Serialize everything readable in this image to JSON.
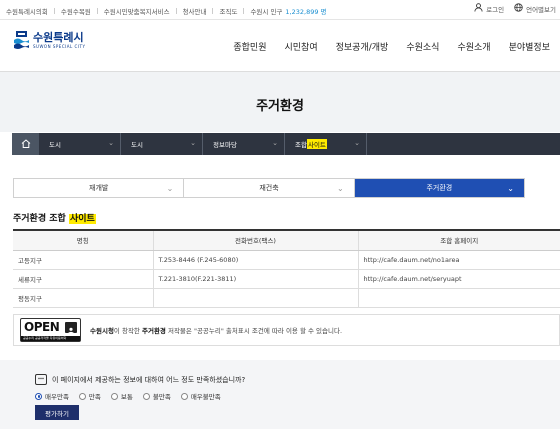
{
  "topbar": {
    "links": [
      "수원특례시의회",
      "수원수목원",
      "수원시민맞춤복지서비스",
      "청사안내",
      "조직도"
    ],
    "population_label": "수원시 인구",
    "population_value": "1,232,899 명",
    "login": "로그인",
    "language": "언어별보기"
  },
  "header": {
    "logo_text": "수원특례시",
    "logo_sub": "SUWON SPECIAL CITY",
    "nav": [
      "종합민원",
      "시민참여",
      "정보공개/개방",
      "수원소식",
      "수원소개",
      "분야별정보"
    ]
  },
  "page_title": "주거환경",
  "breadcrumb": {
    "items": [
      {
        "label": "도시"
      },
      {
        "label": "도시"
      },
      {
        "label": "정보마당"
      },
      {
        "label_prefix": "조합",
        "label_highlight": "사이트"
      }
    ]
  },
  "tabs": [
    {
      "label": "재개발",
      "active": false
    },
    {
      "label": "재건축",
      "active": false
    },
    {
      "label": "주거환경",
      "active": true
    }
  ],
  "section": {
    "title_prefix": "주거환경 조합",
    "title_highlight": "사이트"
  },
  "table": {
    "headers": [
      "명칭",
      "전화번호(팩스)",
      "조합 홈페이지"
    ],
    "rows": [
      [
        "고등지구",
        "T.253-8446 (F.245-6080)",
        "http://cafe.daum.net/no1area"
      ],
      [
        "세류지구",
        "T.221-3810(F.221-3811)",
        "http://cafe.daum.net/seryuapt"
      ],
      [
        "평동지구",
        "",
        ""
      ]
    ]
  },
  "license": {
    "logo_text": "OPEN",
    "logo_strip": "공공누리 공공저작물 자유이용허락",
    "org": "수원시청",
    "mid1": "이 창작한 ",
    "work": "주거환경",
    "rest": " 저작물은 \"공공누리\" 출처표시 조건에 따라 이용 할 수 있습니다."
  },
  "survey": {
    "question": "이 페이지에서 제공하는 정보에 대하여 어느 정도 만족하셨습니까?",
    "options": [
      "매우만족",
      "만족",
      "보통",
      "불만족",
      "매우불만족"
    ],
    "selected": "매우만족",
    "submit": "평가하기"
  },
  "colors": {
    "accent_blue": "#1f4fb3",
    "breadcrumb_bg": "#2e3440",
    "highlight": "#ffeb00",
    "population": "#1a8fd1",
    "button_navy": "#1e2f6b"
  }
}
